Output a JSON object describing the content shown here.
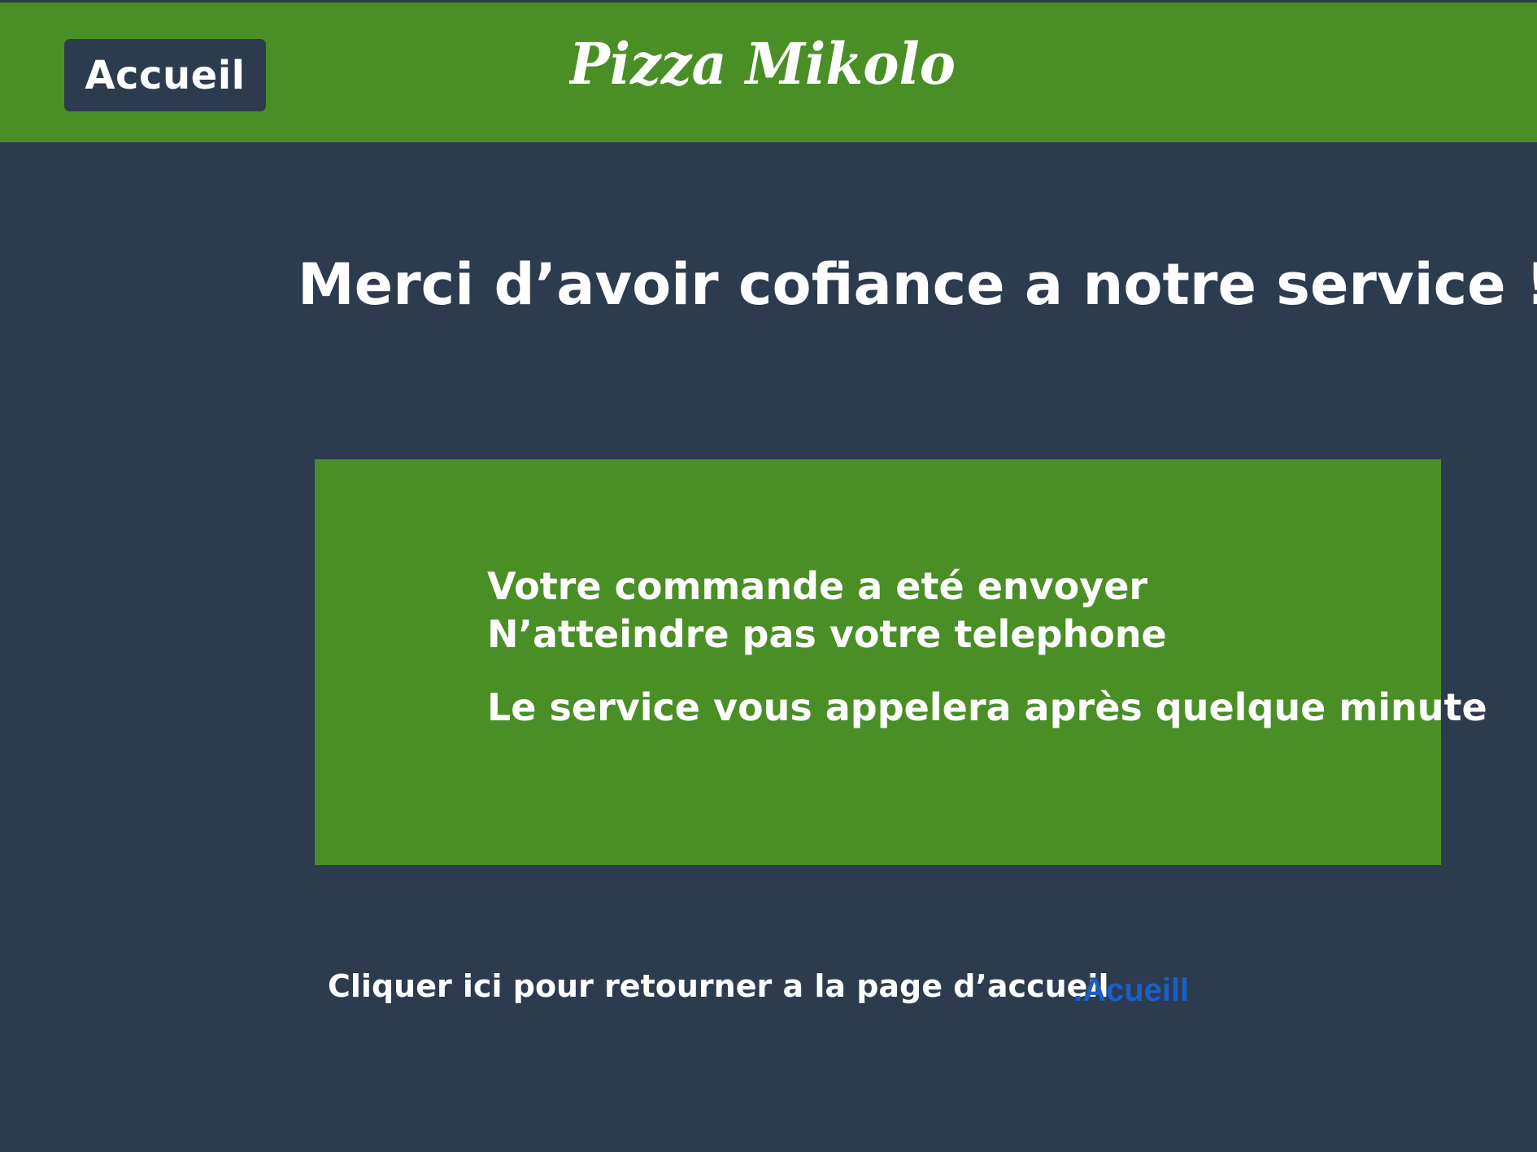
{
  "header": {
    "home_button_label": "Accueil",
    "brand": "Pizza Mikolo"
  },
  "main": {
    "title": "Merci d’avoir cofiance a notre service !",
    "message_lines": [
      "Votre commande a eté envoyer",
      "N’atteindre pas votre telephone",
      "Le service vous appelera après quelque minute"
    ],
    "return_text": "Cliquer ici pour retourner a la page d’accueil",
    "return_link_label": ".Acueill"
  },
  "colors": {
    "page_background": "#2d3b4e",
    "accent_green": "#4a8e26",
    "link_blue": "#1b5fc6",
    "text": "#ffffff"
  }
}
